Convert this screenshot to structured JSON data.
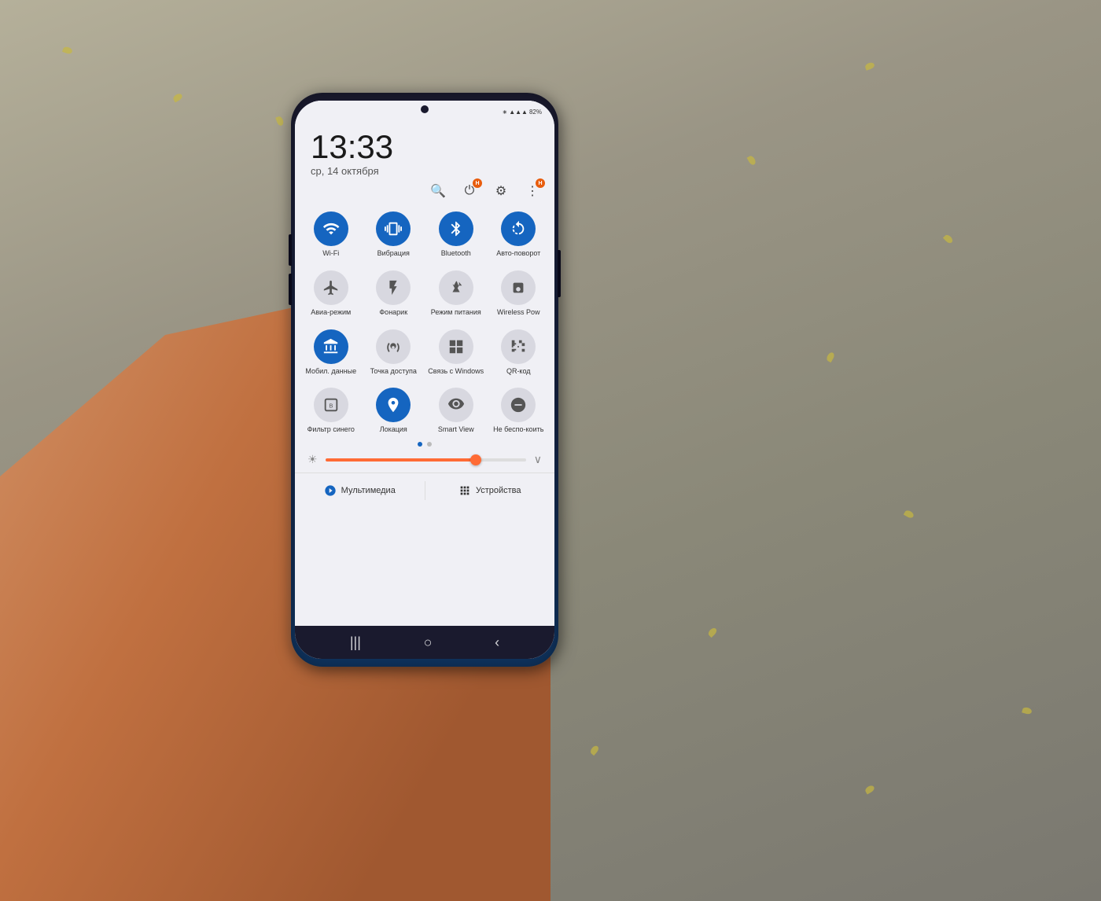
{
  "background": {
    "color": "#9a9585"
  },
  "status_bar": {
    "time": "13:33",
    "date": "ср, 14 октября",
    "battery": "82%",
    "icons": [
      "bluetooth",
      "signal",
      "wifi"
    ]
  },
  "toolbar": {
    "search_label": "🔍",
    "power_label": "⏻",
    "settings_label": "⚙",
    "more_label": "⋮",
    "badge_text": "H"
  },
  "quick_settings": {
    "row1": [
      {
        "id": "wifi",
        "label": "Wi-Fi",
        "active": true,
        "icon": "wifi"
      },
      {
        "id": "vibration",
        "label": "Вибрация",
        "active": true,
        "icon": "vibration"
      },
      {
        "id": "bluetooth",
        "label": "Bluetooth",
        "active": true,
        "icon": "bluetooth"
      },
      {
        "id": "autorotate",
        "label": "Авто-поворот",
        "active": true,
        "icon": "rotate"
      }
    ],
    "row2": [
      {
        "id": "airplane",
        "label": "Авиа-режим",
        "active": false,
        "icon": "airplane"
      },
      {
        "id": "flashlight",
        "label": "Фонарик",
        "active": false,
        "icon": "flashlight"
      },
      {
        "id": "power_mode",
        "label": "Режим питания",
        "active": false,
        "icon": "power_mode"
      },
      {
        "id": "wireless_pow",
        "label": "Wireless Pow",
        "active": false,
        "icon": "wireless"
      }
    ],
    "row3": [
      {
        "id": "mobile_data",
        "label": "Мобил. данные",
        "active": true,
        "icon": "data"
      },
      {
        "id": "hotspot",
        "label": "Точка доступа",
        "active": false,
        "icon": "hotspot"
      },
      {
        "id": "link_windows",
        "label": "Связь с Windows",
        "active": false,
        "icon": "windows"
      },
      {
        "id": "qr",
        "label": "QR-код",
        "active": false,
        "icon": "qr"
      }
    ],
    "row4": [
      {
        "id": "blue_filter",
        "label": "Фильтр синего",
        "active": false,
        "icon": "filter"
      },
      {
        "id": "location",
        "label": "Локация",
        "active": true,
        "icon": "location"
      },
      {
        "id": "smart_view",
        "label": "Smart View",
        "active": false,
        "icon": "smart_view"
      },
      {
        "id": "dnd",
        "label": "Не беспо-коить",
        "active": false,
        "icon": "dnd"
      }
    ]
  },
  "dots": {
    "current": 0,
    "total": 2
  },
  "brightness": {
    "level": 75,
    "icon": "☀"
  },
  "bottom_bar": {
    "media_label": "Мультимедиа",
    "devices_label": "Устройства"
  },
  "nav_bar": {
    "back": "‹",
    "home": "○",
    "recent": "|||"
  }
}
